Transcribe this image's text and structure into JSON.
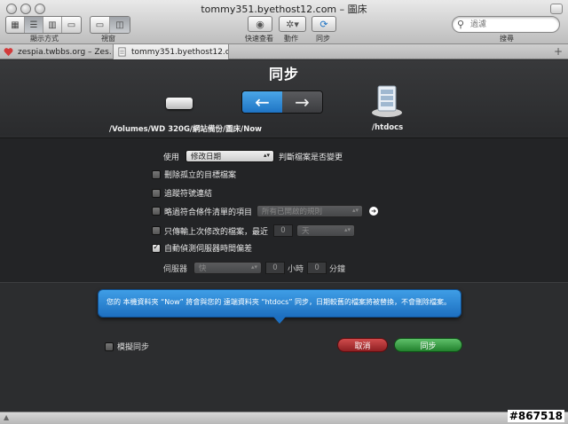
{
  "window": {
    "title": "tommy351.byethost12.com – 圖床"
  },
  "toolbar": {
    "view_mode_label": "顯示方式",
    "view_label": "視窗",
    "quicklook_label": "快速查看",
    "action_label": "動作",
    "sync_label": "同步",
    "search_label": "搜尋",
    "search_placeholder": "過濾"
  },
  "tabs": [
    {
      "label": "zespia.twbbs.org – Zes…",
      "active": false
    },
    {
      "label": "tommy351.byethost12.c…",
      "active": true
    }
  ],
  "sync": {
    "title": "同步",
    "local_path": "/Volumes/WD 320G/網站備份/圖床/Now",
    "remote_path": "/htdocs",
    "direction": "left",
    "compare_prefix": "使用",
    "compare_select": "修改日期",
    "compare_suffix": "判斷檔案是否變更",
    "options": {
      "delete_orphans": {
        "label": "刪除孤立的目標檔案",
        "checked": false
      },
      "follow_symlinks": {
        "label": "追蹤符號連結",
        "checked": false
      },
      "skip_rules": {
        "label": "略過符合條件清單的項目",
        "checked": false,
        "select": "所有已開啟的規則"
      },
      "recent_only": {
        "label": "只傳輸上次修改的檔案，最近",
        "checked": false,
        "value": "0",
        "unit": "天"
      },
      "auto_offset": {
        "label": "自動偵測伺服器時間偏差",
        "checked": true
      }
    },
    "server_row": {
      "label": "伺服器",
      "select": "快",
      "hours_value": "0",
      "hours_label": "小時",
      "minutes_value": "0",
      "minutes_label": "分鐘"
    },
    "bubble_text": "您的 本機資料夾 “Now” 將會與您的 遠端資料夾 “htdocs” 同步，日期較舊的檔案將被替換，不會刪除檔案。",
    "simulate_label": "模擬同步",
    "cancel_label": "取消",
    "sync_button_label": "同步"
  },
  "footer": {
    "stamp": "#867518"
  },
  "colors": {
    "accent": "#2b86d6",
    "sync_green": "#22812d",
    "cancel_red": "#8f1f22"
  }
}
